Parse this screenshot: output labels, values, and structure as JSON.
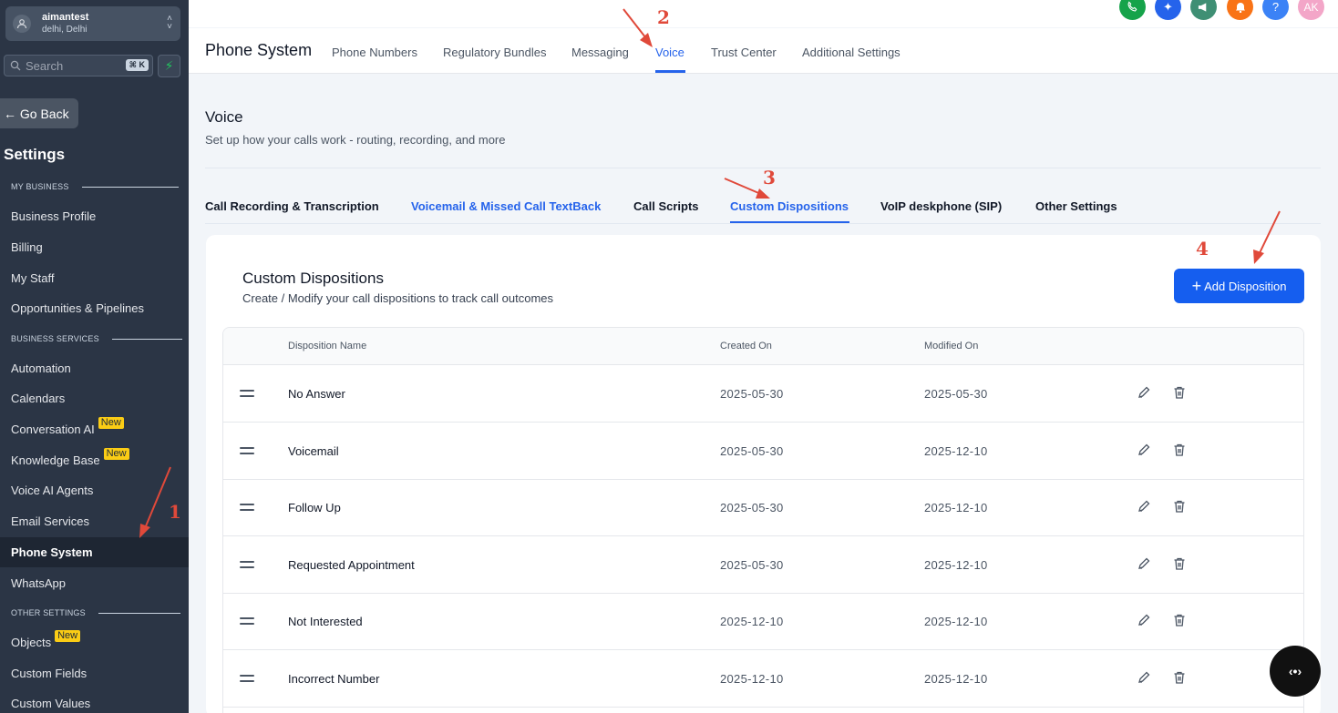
{
  "sidebar": {
    "account": {
      "name": "aimantest",
      "location": "delhi, Delhi"
    },
    "search": {
      "placeholder": "Search",
      "shortcut": "⌘ K"
    },
    "go_back": "← Go Back",
    "title": "Settings",
    "sections": {
      "my_business": "MY BUSINESS",
      "business_services": "BUSINESS SERVICES",
      "other_settings": "OTHER SETTINGS"
    },
    "items": {
      "business_profile": "Business Profile",
      "billing": "Billing",
      "my_staff": "My Staff",
      "opportunities": "Opportunities & Pipelines",
      "automation": "Automation",
      "calendars": "Calendars",
      "conversation_ai": "Conversation AI",
      "knowledge_base": "Knowledge Base",
      "voice_ai_agents": "Voice AI Agents",
      "email_services": "Email Services",
      "phone_system": "Phone System",
      "whatsapp": "WhatsApp",
      "objects": "Objects",
      "custom_fields": "Custom Fields",
      "custom_values": "Custom Values"
    },
    "new_badge": "New"
  },
  "topbar": {
    "avatar_initials": "AK",
    "help": "?",
    "colors": {
      "green": "#16a34a",
      "blue": "#2563eb",
      "teal": "#3f8f74",
      "orange": "#f97316",
      "sky": "#3b82f6",
      "pink": "#f3a6c8"
    }
  },
  "header": {
    "title": "Phone System",
    "tabs": {
      "phone_numbers": "Phone Numbers",
      "regulatory_bundles": "Regulatory Bundles",
      "messaging": "Messaging",
      "voice": "Voice",
      "trust_center": "Trust Center",
      "additional_settings": "Additional Settings"
    }
  },
  "voice": {
    "title": "Voice",
    "subtitle": "Set up how your calls work - routing, recording, and more",
    "tabs": {
      "call_recording": "Call Recording & Transcription",
      "voicemail": "Voicemail & Missed Call TextBack",
      "call_scripts": "Call Scripts",
      "custom_dispositions": "Custom Dispositions",
      "voip": "VoIP deskphone (SIP)",
      "other_settings": "Other Settings"
    }
  },
  "card": {
    "title": "Custom Dispositions",
    "subtitle": "Create / Modify your call dispositions to track call outcomes",
    "add_button": "Add Disposition",
    "columns": {
      "name": "Disposition Name",
      "created": "Created On",
      "modified": "Modified On"
    },
    "rows": [
      {
        "name": "No Answer",
        "created": "2025-05-30",
        "modified": "2025-05-30"
      },
      {
        "name": "Voicemail",
        "created": "2025-05-30",
        "modified": "2025-12-10"
      },
      {
        "name": "Follow Up",
        "created": "2025-05-30",
        "modified": "2025-12-10"
      },
      {
        "name": "Requested Appointment",
        "created": "2025-05-30",
        "modified": "2025-12-10"
      },
      {
        "name": "Not Interested",
        "created": "2025-12-10",
        "modified": "2025-12-10"
      },
      {
        "name": "Incorrect Number",
        "created": "2025-12-10",
        "modified": "2025-12-10"
      }
    ]
  },
  "annotations": {
    "a1": "1",
    "a2": "2",
    "a3": "3",
    "a4": "4",
    "arrow_color": "#e0493a"
  },
  "fab": {
    "label": "‹•›"
  }
}
